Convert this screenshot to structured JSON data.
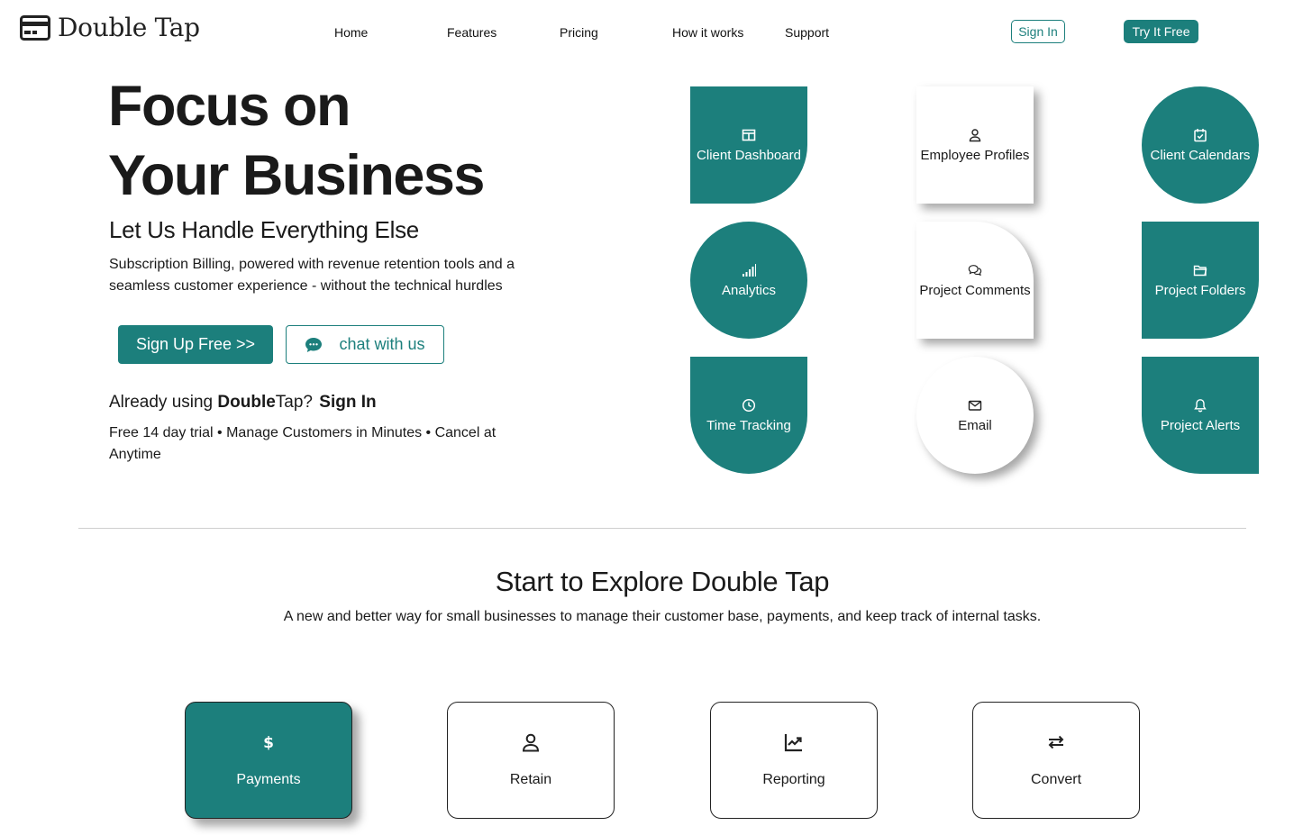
{
  "brand": {
    "name": "Double Tap",
    "icon": "credit-card-icon"
  },
  "nav": {
    "items": [
      {
        "label": "Home"
      },
      {
        "label": "Features"
      },
      {
        "label": "Pricing"
      },
      {
        "label": "How it works"
      },
      {
        "label": "Support"
      }
    ],
    "sign_in": "Sign In",
    "try_free": "Try It Free"
  },
  "hero": {
    "title_line1": "Focus on",
    "title_line2": "Your Business",
    "subtitle": "Let Us Handle Everything Else",
    "description": "Subscription Billing, powered with revenue retention tools and a seamless customer experience - without the technical hurdles",
    "signup_button": "Sign Up Free >>",
    "chat_button": "chat with us",
    "already_prefix": "Already using ",
    "already_brand_bold": "Double",
    "already_brand_rest": "Tap?",
    "already_signin": "Sign In",
    "trial_text": "Free 14 day trial • Manage Customers in Minutes • Cancel at Anytime"
  },
  "features": [
    {
      "label": "Client Dashboard",
      "icon": "layout-icon"
    },
    {
      "label": "Employee Profiles",
      "icon": "person-icon"
    },
    {
      "label": "Client Calendars",
      "icon": "calendar-check-icon"
    },
    {
      "label": "Analytics",
      "icon": "bar-chart-icon"
    },
    {
      "label": "Project Comments",
      "icon": "chat-icon"
    },
    {
      "label": "Project Folders",
      "icon": "folder-icon"
    },
    {
      "label": "Time Tracking",
      "icon": "clock-icon"
    },
    {
      "label": "Email",
      "icon": "envelope-icon"
    },
    {
      "label": "Project Alerts",
      "icon": "bell-icon"
    }
  ],
  "explore": {
    "title": "Start to Explore Double Tap",
    "description": "A new and better way for small businesses to manage their customer base, payments, and keep track of internal tasks.",
    "cards": [
      {
        "label": "Payments",
        "icon": "dollar-icon"
      },
      {
        "label": "Retain",
        "icon": "person-icon"
      },
      {
        "label": "Reporting",
        "icon": "graph-up-icon"
      },
      {
        "label": "Convert",
        "icon": "arrows-icon"
      }
    ]
  },
  "colors": {
    "accent": "#1c7f7c",
    "text": "#212529",
    "background": "#ffffff"
  }
}
